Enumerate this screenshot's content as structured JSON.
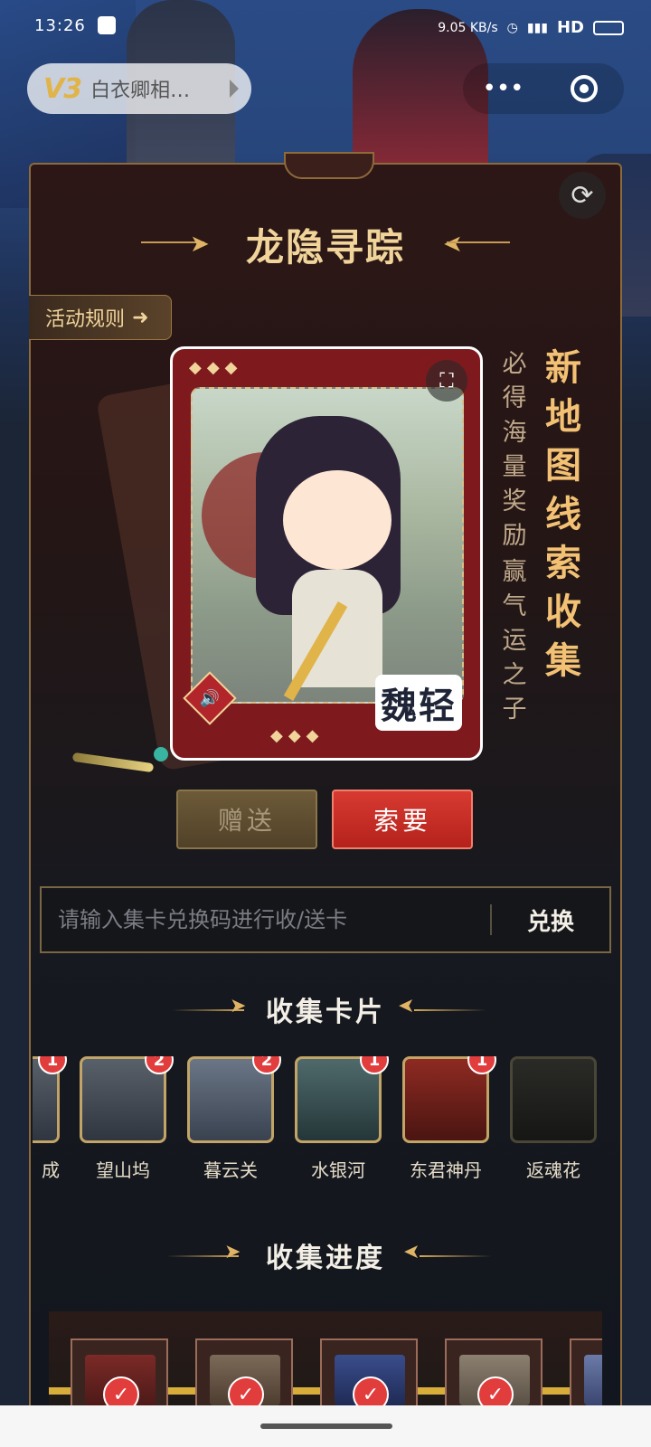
{
  "status_bar": {
    "time": "13:26",
    "network_speed": "9.05 KB/s",
    "hd": "HD"
  },
  "mini_program": {
    "badge": "V3",
    "name": "白衣卿相…",
    "more": "•••"
  },
  "page": {
    "title": "龙隐寻踪",
    "rules_label": "活动规则",
    "card": {
      "name": "魏轻"
    },
    "slogan_main": "新地图线索收集",
    "slogan_side_1": "必得海量奖励",
    "slogan_side_2": "赢气运之子",
    "give_button": "赠送",
    "ask_button": "索要",
    "redeem": {
      "placeholder": "请输入集卡兑换码进行收/送卡",
      "button": "兑换"
    },
    "collect_title": "收集卡片",
    "progress_title": "收集进度"
  },
  "cards": [
    {
      "label": "成",
      "count": "1"
    },
    {
      "label": "望山坞",
      "count": "2"
    },
    {
      "label": "暮云关",
      "count": "2"
    },
    {
      "label": "水银河",
      "count": "1"
    },
    {
      "label": "东君神丹",
      "count": "1"
    },
    {
      "label": "返魂花",
      "count": ""
    }
  ],
  "icons": [
    "refresh-icon",
    "expand-icon",
    "sound-icon",
    "arrow-right-icon",
    "check-icon"
  ],
  "colors": {
    "accent_gold": "#f0d49a",
    "ask_red": "#d73a31",
    "badge_red": "#e23d3d"
  }
}
